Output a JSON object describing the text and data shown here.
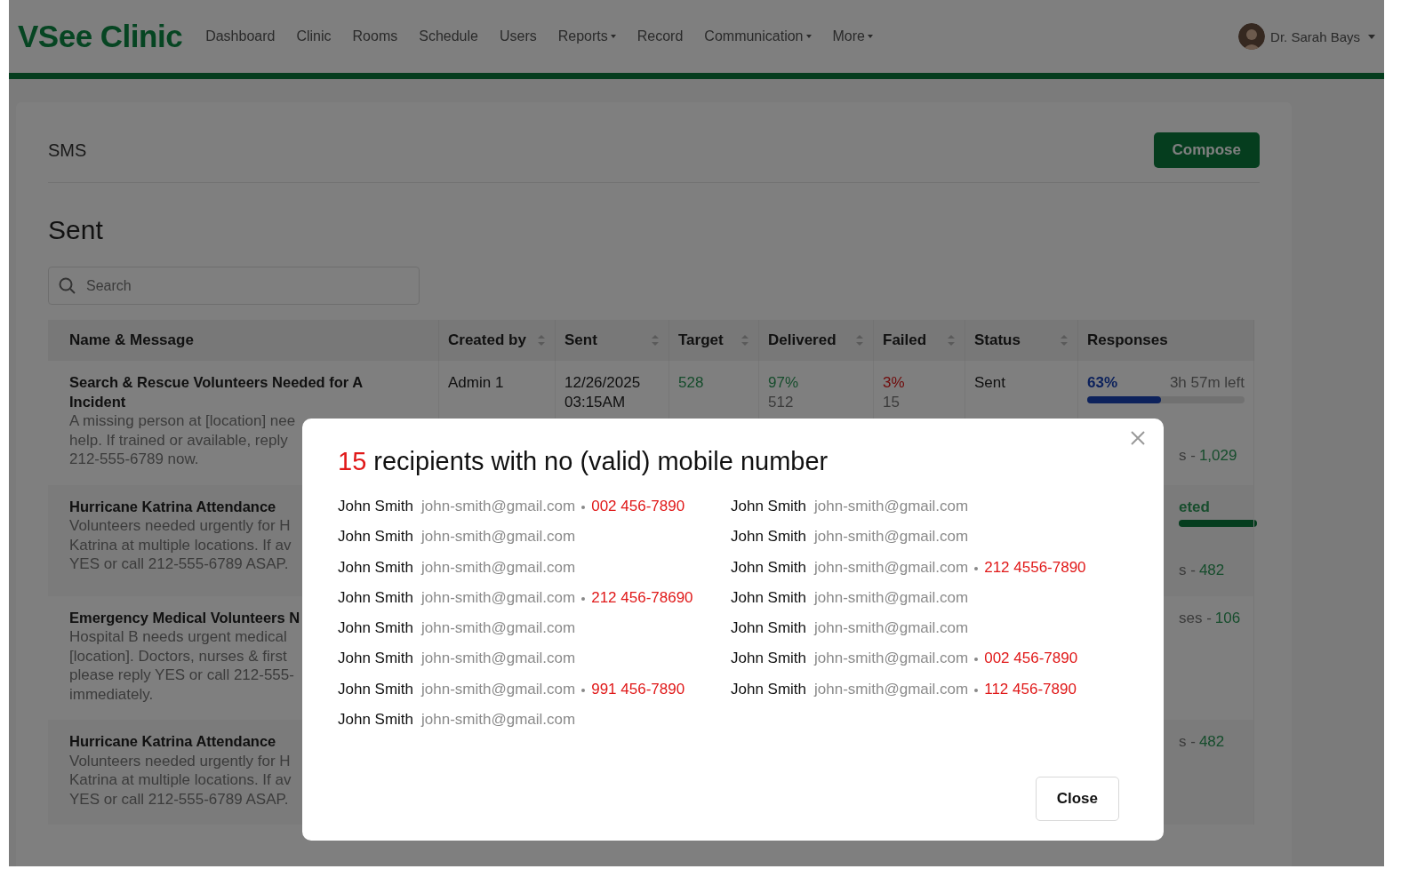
{
  "nav": {
    "logo": "VSee Clinic",
    "items": [
      {
        "label": "Dashboard",
        "dropdown": false
      },
      {
        "label": "Clinic",
        "dropdown": false
      },
      {
        "label": "Rooms",
        "dropdown": false
      },
      {
        "label": "Schedule",
        "dropdown": false
      },
      {
        "label": "Users",
        "dropdown": false
      },
      {
        "label": "Reports",
        "dropdown": true
      },
      {
        "label": "Record",
        "dropdown": false
      },
      {
        "label": "Communication",
        "dropdown": true
      },
      {
        "label": "More",
        "dropdown": true
      }
    ],
    "user": {
      "name": "Dr. Sarah Bays",
      "dropdown": true
    }
  },
  "page": {
    "title": "SMS",
    "compose": "Compose"
  },
  "section_title": "Sent",
  "search": {
    "placeholder": "Search"
  },
  "table": {
    "columns": [
      {
        "label": "Name & Message",
        "sortable": false
      },
      {
        "label": "Created by",
        "sortable": true
      },
      {
        "label": "Sent",
        "sortable": true
      },
      {
        "label": "Target",
        "sortable": true
      },
      {
        "label": "Delivered",
        "sortable": true
      },
      {
        "label": "Failed",
        "sortable": true
      },
      {
        "label": "Status",
        "sortable": true
      },
      {
        "label": "Responses",
        "sortable": false
      }
    ],
    "rows": [
      {
        "title": "Search & Rescue Volunteers Needed for A Incident",
        "message": [
          "A missing person at [location] nee",
          "help. If trained or available, reply",
          "212-555-6789 now."
        ],
        "created_by": "Admin 1",
        "sent": [
          "12/26/2025",
          "03:15AM"
        ],
        "target": "528",
        "delivered": {
          "percent": "97%",
          "count": "512"
        },
        "failed": {
          "percent": "3%",
          "count": "15"
        },
        "status": "Sent",
        "responses": {
          "percent": "63%",
          "time_left": "3h 57m left",
          "level": 0.47,
          "summary_label": "s -",
          "summary_value": "1,029"
        }
      },
      {
        "title": "Hurricane Katrina Attendance",
        "message": [
          "Volunteers needed urgently for H",
          "Katrina at multiple locations. If av",
          "YES or call 212-555-6789 ASAP."
        ],
        "responses": {
          "state": "eted",
          "level": 1,
          "summary_label": "s -",
          "summary_value": "482"
        }
      },
      {
        "title": "Emergency Medical Volunteers N",
        "message": [
          "Hospital B needs urgent medical",
          "[location]. Doctors, nurses & first",
          "please reply YES or call 212-555-",
          "immediately."
        ],
        "responses": {
          "summary_label": "ses -",
          "summary_value": "106"
        }
      },
      {
        "title": "Hurricane Katrina Attendance",
        "message": [
          "Volunteers needed urgently for H",
          "Katrina at multiple locations. If av",
          "YES or call 212-555-6789 ASAP."
        ],
        "responses": {
          "summary_label": "s -",
          "summary_value": "482"
        }
      }
    ]
  },
  "modal": {
    "count": "15",
    "title": "recipients with no (valid) mobile number",
    "columns": [
      [
        {
          "name": "John Smith",
          "email": "john-smith@gmail.com",
          "phone": "002 456-7890"
        },
        {
          "name": "John Smith",
          "email": "john-smith@gmail.com"
        },
        {
          "name": "John Smith",
          "email": "john-smith@gmail.com"
        },
        {
          "name": "John Smith",
          "email": "john-smith@gmail.com",
          "phone": "212 456-78690"
        },
        {
          "name": "John Smith",
          "email": "john-smith@gmail.com"
        },
        {
          "name": "John Smith",
          "email": "john-smith@gmail.com"
        },
        {
          "name": "John Smith",
          "email": "john-smith@gmail.com",
          "phone": "991 456-7890"
        },
        {
          "name": "John Smith",
          "email": "john-smith@gmail.com"
        }
      ],
      [
        {
          "name": "John Smith",
          "email": "john-smith@gmail.com"
        },
        {
          "name": "John Smith",
          "email": "john-smith@gmail.com"
        },
        {
          "name": "John Smith",
          "email": "john-smith@gmail.com",
          "phone": "212 4556-7890"
        },
        {
          "name": "John Smith",
          "email": "john-smith@gmail.com"
        },
        {
          "name": "John Smith",
          "email": "john-smith@gmail.com"
        },
        {
          "name": "John Smith",
          "email": "john-smith@gmail.com",
          "phone": "002 456-7890"
        },
        {
          "name": "John Smith",
          "email": "john-smith@gmail.com",
          "phone": "112 456-7890"
        }
      ]
    ],
    "close": "Close"
  }
}
